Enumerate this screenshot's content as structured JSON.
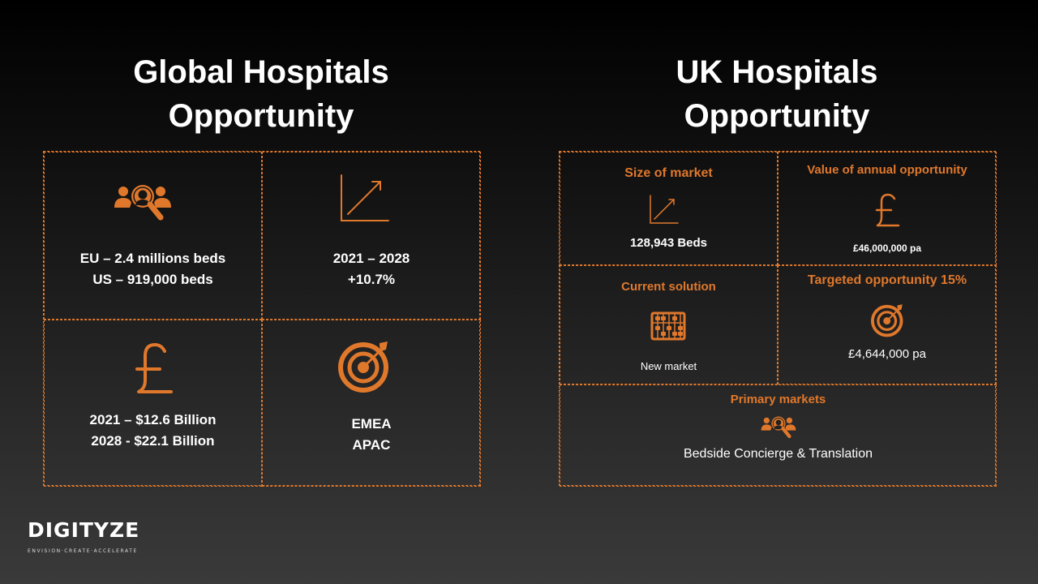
{
  "global": {
    "title_line1": "Global Hospitals",
    "title_line2": "Opportunity",
    "beds_line1": "EU – 2.4 millions beds",
    "beds_line2": "US – 919,000 beds",
    "growth_line1": "2021 – 2028",
    "growth_line2": "+10.7%",
    "value_line1": "2021 – $12.6 Billion",
    "value_line2": "2028 - $22.1 Billion",
    "region_line1": "EMEA",
    "region_line2": "APAC"
  },
  "uk": {
    "title_line1": "UK Hospitals",
    "title_line2": "Opportunity",
    "size_label": "Size of market",
    "size_value": "128,943 Beds",
    "annual_label": "Value of annual opportunity",
    "annual_value": "£46,000,000 pa",
    "current_label": "Current solution",
    "current_value": "New market",
    "targeted_label": "Targeted opportunity  15%",
    "targeted_value": "£4,644,000 pa",
    "primary_label": "Primary markets",
    "primary_value": "Bedside Concierge & Translation"
  },
  "logo": {
    "name": "DIGITYZE",
    "tagline": "ENVISION·CREATE·ACCELERATE"
  },
  "icons": {
    "people": "people-search-icon",
    "growth": "growth-chart-icon",
    "pound": "pound-icon",
    "target": "target-icon",
    "abacus": "abacus-icon"
  },
  "colors": {
    "accent": "#e0782c",
    "text": "#ffffff"
  }
}
